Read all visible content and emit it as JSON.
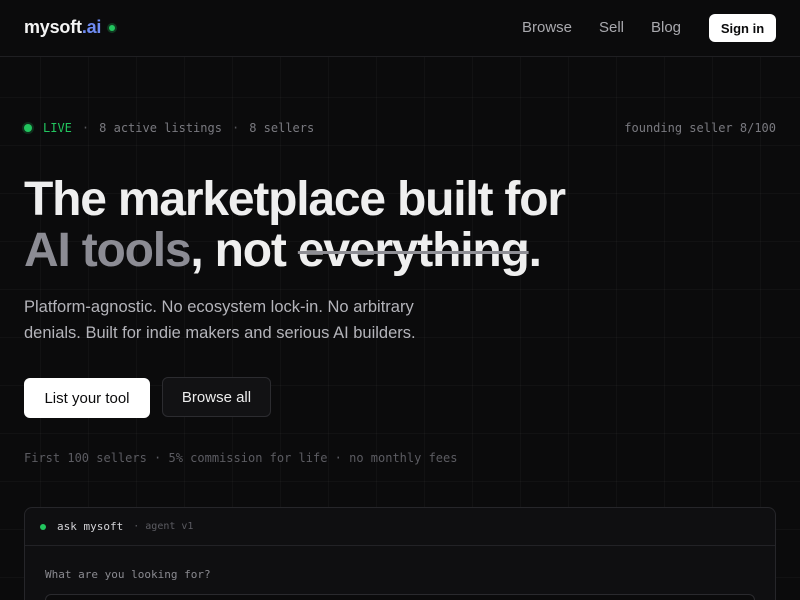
{
  "header": {
    "logo_main": "mysoft",
    "logo_accent": ".ai",
    "nav": [
      "Browse",
      "Sell",
      "Blog"
    ],
    "signin_label": "Sign in"
  },
  "status": {
    "live_label": "LIVE",
    "sep": "·",
    "active_listings": "8 active listings",
    "sellers": "8 sellers",
    "founding": "founding seller 8/100"
  },
  "hero": {
    "headline_line1": "The marketplace built for",
    "headline_ai": "AI tools",
    "headline_not": ", not ",
    "headline_strike": "everything",
    "headline_period": ".",
    "subtext": "Platform-agnostic. No ecosystem lock-in. No arbitrary denials. Built for indie makers and serious AI builders.",
    "primary_button": "List your tool",
    "secondary_button": "Browse all",
    "fine_print": "First 100 sellers · 5% commission for life · no monthly fees"
  },
  "agent": {
    "title": "ask mysoft",
    "version": "· agent v1",
    "prompt": "What are you looking for?",
    "input_value": ""
  },
  "colors": {
    "background": "#0b0b0c",
    "accent_green": "#22c55e",
    "logo_accent": "#6f8cf3"
  }
}
